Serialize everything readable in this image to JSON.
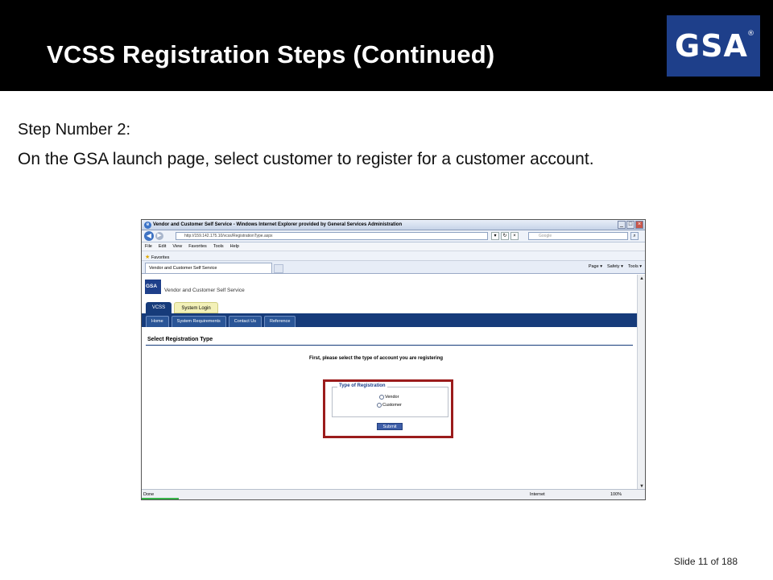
{
  "slide": {
    "title": "VCSS Registration Steps (Continued)",
    "logo_text": "GSA",
    "logo_reg": "®",
    "step_title": "Step Number 2:",
    "step_description": "On the GSA launch page, select customer to register for a customer account.",
    "footer": "Slide 11 of 188"
  },
  "browser": {
    "window_title": "Vendor and Customer Self Service - Windows Internet Explorer provided by General Services Administration",
    "address": "http://159.142.175.10/vcss/RegistrationType.aspx",
    "search_placeholder": "Google",
    "menu": [
      "File",
      "Edit",
      "View",
      "Favorites",
      "Tools",
      "Help"
    ],
    "favorites_label": "Favorites",
    "tab_label": "Vendor and Customer Self Service",
    "command_bar": [
      "Page ▾",
      "Safety ▾",
      "Tools ▾"
    ],
    "status_text": "Done",
    "zone_text": "Internet",
    "zoom_text": "100%",
    "icons": {
      "back": "back-arrow-icon",
      "forward": "forward-arrow-icon",
      "search": "search-icon",
      "favorites": "star-icon"
    }
  },
  "page": {
    "site_logo": "GSA",
    "site_name": "Vendor and Customer Self Service",
    "top_tabs": [
      "VCSS",
      "System Login"
    ],
    "nav_items": [
      "Home",
      "System Requirements",
      "Contact Us",
      "Reference"
    ],
    "section_title": "Select Registration Type",
    "instruction": "First, please select the type of account you are registering",
    "fieldset_legend": "Type of Registration",
    "options": [
      "Vendor",
      "Customer"
    ],
    "submit_label": "Submit"
  },
  "colors": {
    "title_bar": "#000000",
    "gsa_blue": "#1e3f8a",
    "nav_blue": "#163b7a",
    "highlight": "#9b1c1c"
  }
}
